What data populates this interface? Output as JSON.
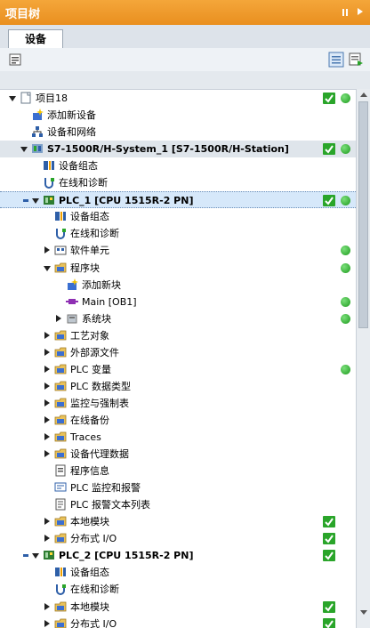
{
  "header": {
    "title": "项目树"
  },
  "tabs": [
    {
      "label": "设备"
    }
  ],
  "colors": {
    "header": "#e98f1f",
    "ok_green": "#2aa52a",
    "selection": "#d6e8fa"
  },
  "tree": {
    "rows": [
      {
        "label": "项目18",
        "icon": "project-icon",
        "arrow": "down",
        "check": true,
        "dot": true
      },
      {
        "label": "添加新设备",
        "icon": "add-device-icon",
        "arrow": "",
        "check": false,
        "dot": false
      },
      {
        "label": "设备和网络",
        "icon": "network-icon",
        "arrow": "",
        "check": false,
        "dot": false
      },
      {
        "label": "S7-1500R/H-System_1 [S7-1500R/H-Station]",
        "icon": "station-icon",
        "arrow": "down",
        "check": true,
        "dot": true,
        "bold": true,
        "style": "dev"
      },
      {
        "label": "设备组态",
        "icon": "device-config-icon",
        "arrow": "",
        "check": false,
        "dot": false
      },
      {
        "label": "在线和诊断",
        "icon": "online-diag-icon",
        "arrow": "",
        "check": false,
        "dot": false
      },
      {
        "label": "PLC_1 [CPU 1515R-2 PN]",
        "icon": "plc-icon",
        "arrow": "down",
        "check": true,
        "dot": true,
        "bold": true,
        "style": "sel",
        "marker": true
      },
      {
        "label": "设备组态",
        "icon": "device-config-icon",
        "arrow": "",
        "check": false,
        "dot": false
      },
      {
        "label": "在线和诊断",
        "icon": "online-diag-icon",
        "arrow": "",
        "check": false,
        "dot": false
      },
      {
        "label": "软件单元",
        "icon": "software-unit-icon",
        "arrow": "right",
        "check": false,
        "dot": true
      },
      {
        "label": "程序块",
        "icon": "folder-icon",
        "arrow": "down",
        "check": false,
        "dot": true
      },
      {
        "label": "添加新块",
        "icon": "add-block-icon",
        "arrow": "",
        "check": false,
        "dot": false
      },
      {
        "label": "Main [OB1]",
        "icon": "ob-block-icon",
        "arrow": "",
        "check": false,
        "dot": true
      },
      {
        "label": "系统块",
        "icon": "system-block-icon",
        "arrow": "right",
        "check": false,
        "dot": true
      },
      {
        "label": "工艺对象",
        "icon": "folder-icon",
        "arrow": "right",
        "check": false,
        "dot": false
      },
      {
        "label": "外部源文件",
        "icon": "folder-icon",
        "arrow": "right",
        "check": false,
        "dot": false
      },
      {
        "label": "PLC 变量",
        "icon": "folder-icon",
        "arrow": "right",
        "check": false,
        "dot": true
      },
      {
        "label": "PLC 数据类型",
        "icon": "folder-icon",
        "arrow": "right",
        "check": false,
        "dot": false
      },
      {
        "label": "监控与强制表",
        "icon": "folder-icon",
        "arrow": "right",
        "check": false,
        "dot": false
      },
      {
        "label": "在线备份",
        "icon": "folder-icon",
        "arrow": "right",
        "check": false,
        "dot": false
      },
      {
        "label": "Traces",
        "icon": "folder-icon",
        "arrow": "right",
        "check": false,
        "dot": false
      },
      {
        "label": "设备代理数据",
        "icon": "folder-icon",
        "arrow": "right",
        "check": false,
        "dot": false
      },
      {
        "label": "程序信息",
        "icon": "program-info-icon",
        "arrow": "",
        "check": false,
        "dot": false
      },
      {
        "label": "PLC 监控和报警",
        "icon": "alarm-icon",
        "arrow": "",
        "check": false,
        "dot": false
      },
      {
        "label": "PLC 报警文本列表",
        "icon": "text-list-icon",
        "arrow": "",
        "check": false,
        "dot": false
      },
      {
        "label": "本地模块",
        "icon": "folder-icon",
        "arrow": "right",
        "check": true,
        "dot": false
      },
      {
        "label": "分布式 I/O",
        "icon": "folder-icon",
        "arrow": "right",
        "check": true,
        "dot": false
      },
      {
        "label": "PLC_2 [CPU 1515R-2 PN]",
        "icon": "plc-icon",
        "arrow": "down",
        "check": true,
        "dot": false,
        "bold": true,
        "marker": true
      },
      {
        "label": "设备组态",
        "icon": "device-config-icon",
        "arrow": "",
        "check": false,
        "dot": false
      },
      {
        "label": "在线和诊断",
        "icon": "online-diag-icon",
        "arrow": "",
        "check": false,
        "dot": false
      },
      {
        "label": "本地模块",
        "icon": "folder-icon",
        "arrow": "right",
        "check": true,
        "dot": false
      },
      {
        "label": "分布式 I/O",
        "icon": "folder-icon",
        "arrow": "right",
        "check": true,
        "dot": false
      }
    ]
  }
}
